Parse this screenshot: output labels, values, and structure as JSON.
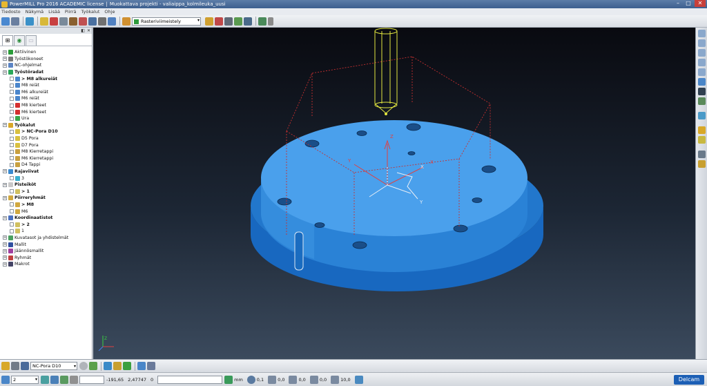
{
  "window": {
    "title": "PowerMILL Pro 2016 ACADEMIC license",
    "project": "Muokattava projekti - valiaippa_kolmileuka_uusi"
  },
  "menu": [
    "Tiedosto",
    "Näkymä",
    "Lisää",
    "Piirrä",
    "Työkalut",
    "Ohje"
  ],
  "toolbar": {
    "strategy_select": "Rasteriviimeistely"
  },
  "explorer": {
    "tree": [
      {
        "label": "Aktiivinen",
        "level": 0,
        "bold": false,
        "icon": "#2a9d3a"
      },
      {
        "label": "Työstökoneet",
        "level": 0,
        "bold": false,
        "icon": "#777777"
      },
      {
        "label": "NC-ohjelmat",
        "level": 0,
        "bold": false,
        "icon": "#5b84c4"
      },
      {
        "label": "Työstöradat",
        "level": 0,
        "bold": true,
        "icon": "#2aa85a"
      },
      {
        "label": "> M8 alkureiät",
        "level": 1,
        "bold": true,
        "icon": "#4a86cc"
      },
      {
        "label": "M8 reiät",
        "level": 1,
        "bold": false,
        "icon": "#4a86cc"
      },
      {
        "label": "M6 alkureiät",
        "level": 1,
        "bold": false,
        "icon": "#4a86cc"
      },
      {
        "label": "M6 reiät",
        "level": 1,
        "bold": false,
        "icon": "#4a86cc"
      },
      {
        "label": "M8 kierteet",
        "level": 1,
        "bold": false,
        "icon": "#d43030"
      },
      {
        "label": "M6 kierteet",
        "level": 1,
        "bold": false,
        "icon": "#d43030"
      },
      {
        "label": "Ura",
        "level": 1,
        "bold": false,
        "icon": "#3aa84a"
      },
      {
        "label": "Työkalut",
        "level": 0,
        "bold": true,
        "icon": "#d8a828"
      },
      {
        "label": "> NC-Pora D10",
        "level": 1,
        "bold": true,
        "icon": "#d8c040"
      },
      {
        "label": "D5 Pora",
        "level": 1,
        "bold": false,
        "icon": "#d8c040"
      },
      {
        "label": "D7 Pora",
        "level": 1,
        "bold": false,
        "icon": "#d8c040"
      },
      {
        "label": "M8 Kierretappi",
        "level": 1,
        "bold": false,
        "icon": "#c8a040"
      },
      {
        "label": "M6 Kierretappi",
        "level": 1,
        "bold": false,
        "icon": "#c8a040"
      },
      {
        "label": "D4 Tappi",
        "level": 1,
        "bold": false,
        "icon": "#c8a040"
      },
      {
        "label": "Rajaviivat",
        "level": 0,
        "bold": true,
        "icon": "#3a8ad0"
      },
      {
        "label": "3",
        "level": 1,
        "bold": false,
        "icon": "#3ab0d0"
      },
      {
        "label": "Pisteiköt",
        "level": 0,
        "bold": true,
        "icon": "#c8c8c8"
      },
      {
        "label": "> 1",
        "level": 1,
        "bold": true,
        "icon": "#d0c060"
      },
      {
        "label": "Piirreryhmät",
        "level": 0,
        "bold": true,
        "icon": "#d0a840"
      },
      {
        "label": "> M8",
        "level": 1,
        "bold": true,
        "icon": "#d0a840"
      },
      {
        "label": "M6",
        "level": 1,
        "bold": false,
        "icon": "#d0a840"
      },
      {
        "label": "Koordinaatistot",
        "level": 0,
        "bold": true,
        "icon": "#4a70c0"
      },
      {
        "label": "> 2",
        "level": 1,
        "bold": true,
        "icon": "#d0c060"
      },
      {
        "label": "1",
        "level": 1,
        "bold": false,
        "icon": "#d0c060"
      },
      {
        "label": "Kuvatasot ja yhdistelmät",
        "level": 0,
        "bold": false,
        "icon": "#4aa060"
      },
      {
        "label": "Mallit",
        "level": 0,
        "bold": false,
        "icon": "#3050a0"
      },
      {
        "label": "Jäännösmallit",
        "level": 0,
        "bold": false,
        "icon": "#a040a0"
      },
      {
        "label": "Ryhmät",
        "level": 0,
        "bold": false,
        "icon": "#c04040"
      },
      {
        "label": "Makrot",
        "level": 0,
        "bold": false,
        "icon": "#444466"
      }
    ]
  },
  "viewport": {
    "axis_labels": {
      "x": "X",
      "y": "Y",
      "z": "Z"
    }
  },
  "bottom": {
    "tool_select": "NC-Pora D10",
    "workplane_select": "2",
    "coord_x": "-191,65",
    "coord_y": "2,47747",
    "coord_z": "0",
    "units": "mm",
    "tolerance": "0,1",
    "thickness": "0,0",
    "axial_thickness": "0,0",
    "stepover": "0,0",
    "stepdown": "10,0",
    "brand": "Delcam"
  },
  "colors": {
    "part_top": "#4aa0ec",
    "part_side": "#2a82d6",
    "part_base": "#1868c0",
    "tool": "#e4e840",
    "block": "#c83030"
  }
}
